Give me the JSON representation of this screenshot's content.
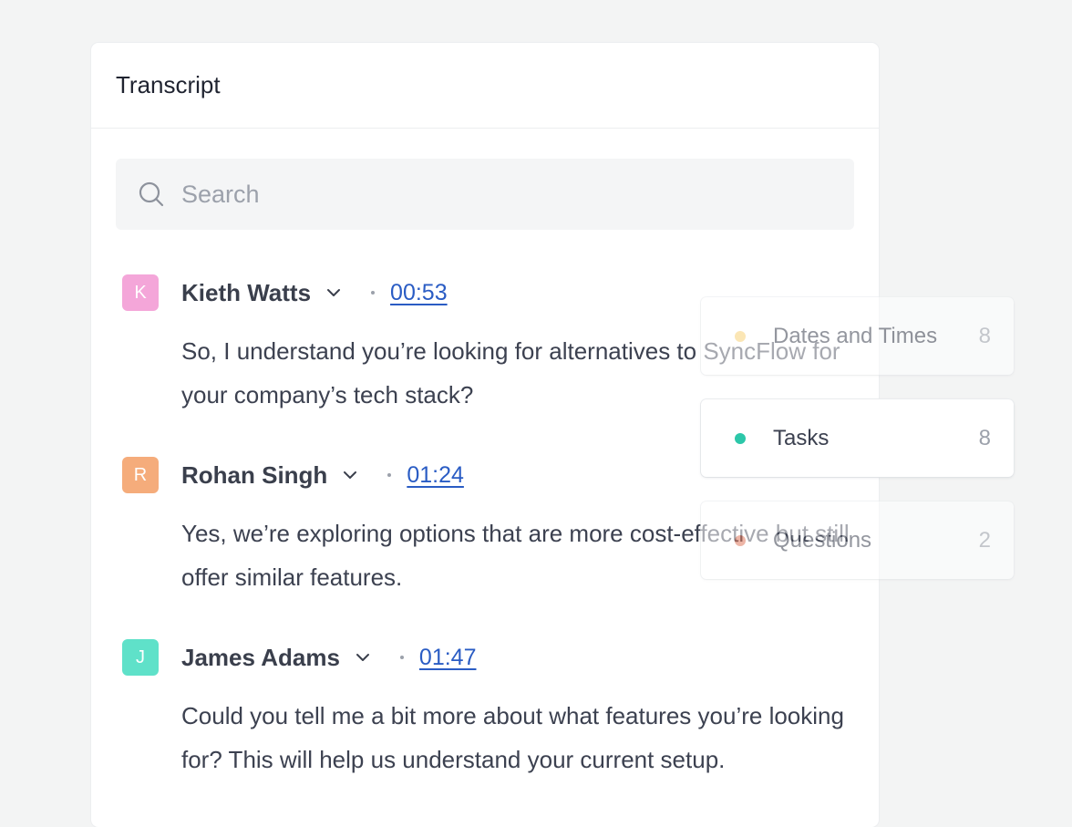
{
  "header": {
    "title": "Transcript"
  },
  "search": {
    "placeholder": "Search",
    "value": ""
  },
  "transcript": [
    {
      "initial": "K",
      "speaker": "Kieth Watts",
      "time": "00:53",
      "text": "So, I understand you’re looking for alternatives to SyncFlow for your company’s tech stack?",
      "color": "#f4a6d9"
    },
    {
      "initial": "R",
      "speaker": "Rohan Singh",
      "time": "01:24",
      "text": "Yes, we’re exploring options that are more cost-effective but still offer similar features.",
      "color": "#f5ac7b"
    },
    {
      "initial": "J",
      "speaker": "James Adams",
      "time": "01:47",
      "text": "Could you tell me a bit more about what features you’re looking for? This will help us understand your current setup.",
      "color": "#5fe1c9"
    }
  ],
  "tags": [
    {
      "label": "Dates and Times",
      "count": "8",
      "color": "#f9d27a"
    },
    {
      "label": "Tasks",
      "count": "8",
      "color": "#2cc7a9"
    },
    {
      "label": "Questions",
      "count": "2",
      "color": "#e07a5f"
    }
  ]
}
